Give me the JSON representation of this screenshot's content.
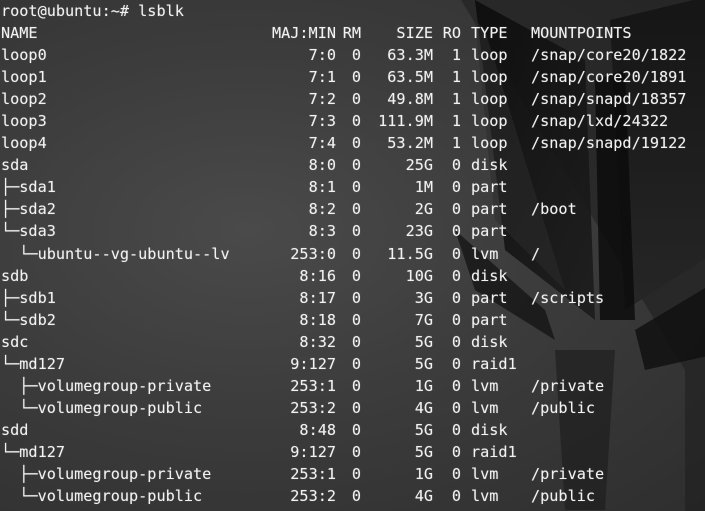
{
  "terminal": {
    "prompt": "root@ubuntu:~# lsblk",
    "headers": {
      "name": "NAME",
      "majmin": "MAJ:MIN",
      "rm": "RM",
      "size": "SIZE",
      "ro": "RO",
      "type": "TYPE",
      "mountpoints": "MOUNTPOINTS"
    },
    "rows": [
      {
        "name": "loop0",
        "majmin": "7:0",
        "rm": "0",
        "size": "63.3M",
        "ro": "1",
        "type": "loop",
        "mountpoints": "/snap/core20/1822"
      },
      {
        "name": "loop1",
        "majmin": "7:1",
        "rm": "0",
        "size": "63.5M",
        "ro": "1",
        "type": "loop",
        "mountpoints": "/snap/core20/1891"
      },
      {
        "name": "loop2",
        "majmin": "7:2",
        "rm": "0",
        "size": "49.8M",
        "ro": "1",
        "type": "loop",
        "mountpoints": "/snap/snapd/18357"
      },
      {
        "name": "loop3",
        "majmin": "7:3",
        "rm": "0",
        "size": "111.9M",
        "ro": "1",
        "type": "loop",
        "mountpoints": "/snap/lxd/24322"
      },
      {
        "name": "loop4",
        "majmin": "7:4",
        "rm": "0",
        "size": "53.2M",
        "ro": "1",
        "type": "loop",
        "mountpoints": "/snap/snapd/19122"
      },
      {
        "name": "sda",
        "majmin": "8:0",
        "rm": "0",
        "size": "25G",
        "ro": "0",
        "type": "disk",
        "mountpoints": ""
      },
      {
        "name": "├─sda1",
        "majmin": "8:1",
        "rm": "0",
        "size": "1M",
        "ro": "0",
        "type": "part",
        "mountpoints": ""
      },
      {
        "name": "├─sda2",
        "majmin": "8:2",
        "rm": "0",
        "size": "2G",
        "ro": "0",
        "type": "part",
        "mountpoints": "/boot"
      },
      {
        "name": "└─sda3",
        "majmin": "8:3",
        "rm": "0",
        "size": "23G",
        "ro": "0",
        "type": "part",
        "mountpoints": ""
      },
      {
        "name": "  └─ubuntu--vg-ubuntu--lv",
        "majmin": "253:0",
        "rm": "0",
        "size": "11.5G",
        "ro": "0",
        "type": "lvm",
        "mountpoints": "/"
      },
      {
        "name": "sdb",
        "majmin": "8:16",
        "rm": "0",
        "size": "10G",
        "ro": "0",
        "type": "disk",
        "mountpoints": ""
      },
      {
        "name": "├─sdb1",
        "majmin": "8:17",
        "rm": "0",
        "size": "3G",
        "ro": "0",
        "type": "part",
        "mountpoints": "/scripts"
      },
      {
        "name": "└─sdb2",
        "majmin": "8:18",
        "rm": "0",
        "size": "7G",
        "ro": "0",
        "type": "part",
        "mountpoints": ""
      },
      {
        "name": "sdc",
        "majmin": "8:32",
        "rm": "0",
        "size": "5G",
        "ro": "0",
        "type": "disk",
        "mountpoints": ""
      },
      {
        "name": "└─md127",
        "majmin": "9:127",
        "rm": "0",
        "size": "5G",
        "ro": "0",
        "type": "raid1",
        "mountpoints": ""
      },
      {
        "name": "  ├─volumegroup-private",
        "majmin": "253:1",
        "rm": "0",
        "size": "1G",
        "ro": "0",
        "type": "lvm",
        "mountpoints": "/private"
      },
      {
        "name": "  └─volumegroup-public",
        "majmin": "253:2",
        "rm": "0",
        "size": "4G",
        "ro": "0",
        "type": "lvm",
        "mountpoints": "/public"
      },
      {
        "name": "sdd",
        "majmin": "8:48",
        "rm": "0",
        "size": "5G",
        "ro": "0",
        "type": "disk",
        "mountpoints": ""
      },
      {
        "name": "└─md127",
        "majmin": "9:127",
        "rm": "0",
        "size": "5G",
        "ro": "0",
        "type": "raid1",
        "mountpoints": ""
      },
      {
        "name": "  ├─volumegroup-private",
        "majmin": "253:1",
        "rm": "0",
        "size": "1G",
        "ro": "0",
        "type": "lvm",
        "mountpoints": "/private"
      },
      {
        "name": "  └─volumegroup-public",
        "majmin": "253:2",
        "rm": "0",
        "size": "4G",
        "ro": "0",
        "type": "lvm",
        "mountpoints": "/public"
      }
    ]
  }
}
